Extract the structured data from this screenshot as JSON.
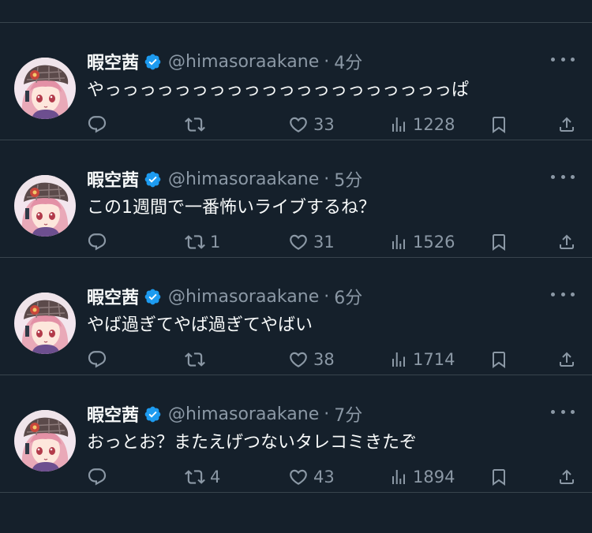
{
  "colors": {
    "background": "#15202b",
    "divider": "#38444d",
    "text_primary": "#f7f9f9",
    "text_secondary": "#8b98a5",
    "verified_badge": "#1d9bf0"
  },
  "icons": {
    "verified": "verified-badge-icon",
    "more": "more-dots-icon",
    "reply": "reply-icon",
    "retweet": "retweet-icon",
    "like": "heart-icon",
    "views": "views-icon",
    "bookmark": "bookmark-icon",
    "share": "share-icon"
  },
  "tweets": [
    {
      "display_name": "暇空茜",
      "handle": "@himasoraakane",
      "separator": "·",
      "time": "4分",
      "text": "やっっっっっっっっっっっっっっっっっっっっぱ",
      "replies": "",
      "retweets": "",
      "likes": "33",
      "views": "1228"
    },
    {
      "display_name": "暇空茜",
      "handle": "@himasoraakane",
      "separator": "·",
      "time": "5分",
      "text": "この1週間で一番怖いライブするね？",
      "replies": "",
      "retweets": "1",
      "likes": "31",
      "views": "1526"
    },
    {
      "display_name": "暇空茜",
      "handle": "@himasoraakane",
      "separator": "·",
      "time": "6分",
      "text": "やば過ぎてやば過ぎてやばい",
      "replies": "",
      "retweets": "",
      "likes": "38",
      "views": "1714"
    },
    {
      "display_name": "暇空茜",
      "handle": "@himasoraakane",
      "separator": "·",
      "time": "7分",
      "text": "おっとお？またえげつないタレコミきたぞ",
      "replies": "",
      "retweets": "4",
      "likes": "43",
      "views": "1894"
    }
  ]
}
